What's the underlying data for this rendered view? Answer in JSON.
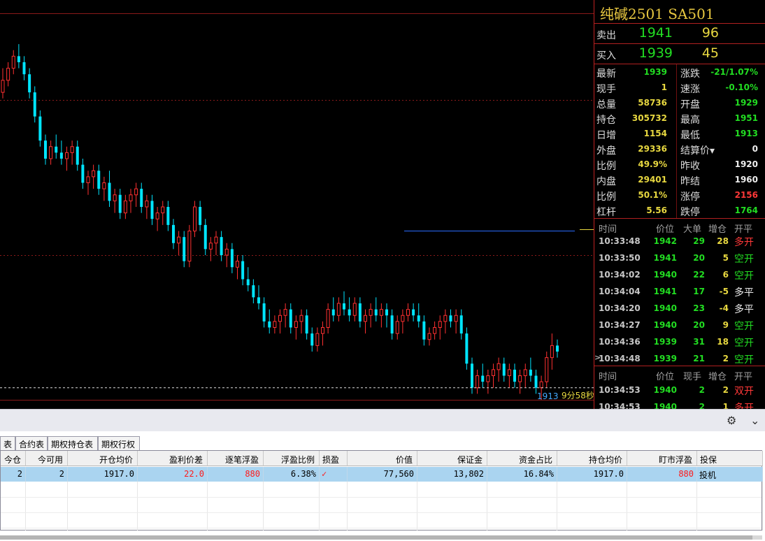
{
  "quote": {
    "title": "纯碱2501 SA501",
    "orderbook": [
      {
        "label": "卖出",
        "price": "1941",
        "volume": "96"
      },
      {
        "label": "买入",
        "price": "1939",
        "volume": "45"
      }
    ],
    "stats": [
      {
        "l1": "最新",
        "v1": "1939",
        "c1": "grn",
        "l2": "涨跌",
        "v2": "-21/1.07%",
        "c2": "grn"
      },
      {
        "l1": "现手",
        "v1": "1",
        "c1": "yel",
        "l2": "速涨",
        "v2": "-0.10%",
        "c2": "grn"
      },
      {
        "l1": "总量",
        "v1": "58736",
        "c1": "yel",
        "l2": "开盘",
        "v2": "1929",
        "c2": "grn"
      },
      {
        "l1": "持仓",
        "v1": "305732",
        "c1": "yel",
        "l2": "最高",
        "v2": "1951",
        "c2": "grn"
      },
      {
        "l1": "日增",
        "v1": "1154",
        "c1": "yel",
        "l2": "最低",
        "v2": "1913",
        "c2": "grn"
      },
      {
        "l1": "外盘",
        "v1": "29336",
        "c1": "yel",
        "l2": "结算价▾",
        "v2": "0",
        "c2": "wht"
      },
      {
        "l1": "比例",
        "v1": "49.9%",
        "c1": "yel",
        "l2": "昨收",
        "v2": "1920",
        "c2": "wht"
      },
      {
        "l1": "内盘",
        "v1": "29401",
        "c1": "yel",
        "l2": "昨结",
        "v2": "1960",
        "c2": "wht"
      },
      {
        "l1": "比例",
        "v1": "50.1%",
        "c1": "yel",
        "l2": "涨停",
        "v2": "2156",
        "c2": "red"
      },
      {
        "l1": "杠杆",
        "v1": "5.56",
        "c1": "yel",
        "l2": "跌停",
        "v2": "1764",
        "c2": "grn"
      }
    ],
    "ticks_header": [
      "时间",
      "价位",
      "大单",
      "增仓",
      "开平"
    ],
    "ticks": [
      {
        "time": "10:33:48",
        "price": "1942",
        "big": "29",
        "big_color": "red",
        "add": "28",
        "add_color": "yel",
        "type": "多开",
        "type_color": "red"
      },
      {
        "time": "10:33:50",
        "price": "1941",
        "big": "20",
        "big_color": "grn",
        "add": "5",
        "add_color": "yel",
        "type": "空开",
        "type_color": "grn"
      },
      {
        "time": "10:34:02",
        "price": "1940",
        "big": "22",
        "big_color": "grn",
        "add": "6",
        "add_color": "yel",
        "type": "空开",
        "type_color": "grn"
      },
      {
        "time": "10:34:04",
        "price": "1941",
        "big": "17",
        "big_color": "grn",
        "add": "-5",
        "add_color": "yel",
        "type": "多平",
        "type_color": "wht"
      },
      {
        "time": "10:34:20",
        "price": "1940",
        "big": "23",
        "big_color": "grn",
        "add": "-4",
        "add_color": "yel",
        "type": "多平",
        "type_color": "wht"
      },
      {
        "time": "10:34:27",
        "price": "1940",
        "big": "20",
        "big_color": "grn",
        "add": "9",
        "add_color": "yel",
        "type": "空开",
        "type_color": "grn"
      },
      {
        "time": "10:34:36",
        "price": "1939",
        "big": "31",
        "big_color": "grn",
        "add": "18",
        "add_color": "yel",
        "type": "空开",
        "type_color": "grn"
      },
      {
        "time": "10:34:48",
        "price": "1939",
        "big": "21",
        "big_color": "grn",
        "add": "2",
        "add_color": "yel",
        "type": "空开",
        "type_color": "grn"
      }
    ],
    "ticks2_header": [
      "时间",
      "价位",
      "现手",
      "增仓",
      "开平"
    ],
    "ticks2": [
      {
        "time": "10:34:53",
        "price": "1940",
        "big": "2",
        "big_color": "red",
        "add": "2",
        "add_color": "yel",
        "type": "双开",
        "type_color": "red"
      },
      {
        "time": "10:34:53",
        "price": "1940",
        "big": "2",
        "big_color": "red",
        "add": "1",
        "add_color": "yel",
        "type": "多开",
        "type_color": "red"
      }
    ]
  },
  "chart": {
    "low_label": "1913",
    "countdown_label": "9分58秒",
    "colors": {
      "up": "#ff3030",
      "down": "#00e5ff",
      "grid": "#8b1a1a",
      "line": "#2a6cff"
    }
  },
  "chart_data": {
    "type": "candlestick",
    "title": "",
    "ylim": [
      1911,
      1975
    ],
    "reference_lines": {
      "last_price": 1939,
      "low": 1913
    },
    "candles": [
      [
        1962,
        1966,
        1961,
        1964
      ],
      [
        1964,
        1967,
        1963,
        1966
      ],
      [
        1966,
        1969,
        1965,
        1968
      ],
      [
        1968,
        1970,
        1966,
        1967
      ],
      [
        1967,
        1968,
        1964,
        1965
      ],
      [
        1965,
        1966,
        1961,
        1962
      ],
      [
        1962,
        1963,
        1957,
        1958
      ],
      [
        1958,
        1959,
        1953,
        1954
      ],
      [
        1954,
        1955,
        1950,
        1951
      ],
      [
        1951,
        1954,
        1950,
        1953
      ],
      [
        1953,
        1955,
        1951,
        1952
      ],
      [
        1952,
        1954,
        1950,
        1951
      ],
      [
        1951,
        1953,
        1949,
        1952
      ],
      [
        1952,
        1954,
        1950,
        1953
      ],
      [
        1953,
        1954,
        1949,
        1950
      ],
      [
        1950,
        1951,
        1946,
        1947
      ],
      [
        1947,
        1949,
        1945,
        1948
      ],
      [
        1948,
        1950,
        1946,
        1949
      ],
      [
        1949,
        1950,
        1945,
        1946
      ],
      [
        1946,
        1948,
        1944,
        1947
      ],
      [
        1947,
        1949,
        1943,
        1944
      ],
      [
        1944,
        1946,
        1942,
        1945
      ],
      [
        1945,
        1946,
        1941,
        1942
      ],
      [
        1942,
        1945,
        1941,
        1944
      ],
      [
        1944,
        1946,
        1942,
        1945
      ],
      [
        1945,
        1947,
        1943,
        1946
      ],
      [
        1946,
        1947,
        1942,
        1943
      ],
      [
        1943,
        1945,
        1941,
        1944
      ],
      [
        1944,
        1945,
        1940,
        1941
      ],
      [
        1941,
        1943,
        1939,
        1942
      ],
      [
        1942,
        1944,
        1940,
        1943
      ],
      [
        1943,
        1944,
        1939,
        1940
      ],
      [
        1940,
        1941,
        1936,
        1937
      ],
      [
        1937,
        1939,
        1935,
        1938
      ],
      [
        1938,
        1939,
        1933,
        1934
      ],
      [
        1934,
        1940,
        1933,
        1939
      ],
      [
        1939,
        1944,
        1938,
        1943
      ],
      [
        1943,
        1944,
        1939,
        1940
      ],
      [
        1940,
        1941,
        1935,
        1936
      ],
      [
        1936,
        1938,
        1934,
        1937
      ],
      [
        1937,
        1939,
        1935,
        1938
      ],
      [
        1938,
        1939,
        1934,
        1935
      ],
      [
        1935,
        1937,
        1933,
        1936
      ],
      [
        1936,
        1937,
        1932,
        1933
      ],
      [
        1933,
        1935,
        1931,
        1934
      ],
      [
        1934,
        1935,
        1930,
        1931
      ],
      [
        1931,
        1933,
        1929,
        1930
      ],
      [
        1930,
        1931,
        1927,
        1928
      ],
      [
        1928,
        1930,
        1926,
        1927
      ],
      [
        1927,
        1928,
        1923,
        1924
      ],
      [
        1924,
        1926,
        1922,
        1923
      ],
      [
        1923,
        1925,
        1922,
        1924
      ],
      [
        1924,
        1926,
        1922,
        1925
      ],
      [
        1925,
        1927,
        1923,
        1926
      ],
      [
        1926,
        1927,
        1922,
        1923
      ],
      [
        1923,
        1925,
        1921,
        1924
      ],
      [
        1924,
        1926,
        1922,
        1925
      ],
      [
        1925,
        1926,
        1921,
        1922
      ],
      [
        1922,
        1923,
        1919,
        1920
      ],
      [
        1920,
        1923,
        1919,
        1922
      ],
      [
        1922,
        1924,
        1920,
        1923
      ],
      [
        1923,
        1927,
        1922,
        1926
      ],
      [
        1926,
        1928,
        1924,
        1925
      ],
      [
        1925,
        1928,
        1924,
        1927
      ],
      [
        1927,
        1929,
        1925,
        1926
      ],
      [
        1926,
        1928,
        1924,
        1925
      ],
      [
        1925,
        1928,
        1924,
        1927
      ],
      [
        1927,
        1928,
        1923,
        1924
      ],
      [
        1924,
        1926,
        1922,
        1925
      ],
      [
        1925,
        1927,
        1923,
        1926
      ],
      [
        1926,
        1928,
        1924,
        1925
      ],
      [
        1925,
        1927,
        1923,
        1926
      ],
      [
        1926,
        1927,
        1923,
        1925
      ],
      [
        1925,
        1926,
        1921,
        1922
      ],
      [
        1922,
        1925,
        1921,
        1924
      ],
      [
        1924,
        1926,
        1922,
        1925
      ],
      [
        1925,
        1927,
        1924,
        1926
      ],
      [
        1926,
        1927,
        1924,
        1925
      ],
      [
        1925,
        1927,
        1923,
        1924
      ],
      [
        1924,
        1925,
        1920,
        1921
      ],
      [
        1921,
        1923,
        1920,
        1922
      ],
      [
        1922,
        1924,
        1921,
        1923
      ],
      [
        1923,
        1925,
        1921,
        1924
      ],
      [
        1924,
        1926,
        1922,
        1925
      ],
      [
        1925,
        1926,
        1923,
        1924
      ],
      [
        1924,
        1926,
        1922,
        1925
      ],
      [
        1925,
        1926,
        1921,
        1922
      ],
      [
        1922,
        1923,
        1916,
        1917
      ],
      [
        1917,
        1918,
        1912,
        1913
      ],
      [
        1913,
        1916,
        1912,
        1915
      ],
      [
        1915,
        1917,
        1913,
        1914
      ],
      [
        1914,
        1916,
        1912,
        1915
      ],
      [
        1915,
        1917,
        1913,
        1916
      ],
      [
        1916,
        1918,
        1914,
        1917
      ],
      [
        1917,
        1918,
        1914,
        1915
      ],
      [
        1915,
        1917,
        1913,
        1916
      ],
      [
        1916,
        1917,
        1913,
        1914
      ],
      [
        1914,
        1916,
        1912,
        1915
      ],
      [
        1915,
        1917,
        1913,
        1916
      ],
      [
        1916,
        1918,
        1914,
        1915
      ],
      [
        1915,
        1916,
        1912,
        1913
      ],
      [
        1913,
        1915,
        1911,
        1914
      ],
      [
        1914,
        1919,
        1913,
        1918
      ],
      [
        1918,
        1922,
        1916,
        1920
      ],
      [
        1920,
        1921,
        1918,
        1919
      ]
    ]
  },
  "toolbar": {
    "settings_icon": "gear-icon",
    "collapse_icon": "chevron-down-icon"
  },
  "tabs": [
    "表",
    "合约表",
    "期权持仓表",
    "期权行权"
  ],
  "grid": {
    "columns": [
      "今仓",
      "今可用",
      "开仓均价",
      "盈利价差",
      "逐笔浮盈",
      "浮盈比例",
      "损盈",
      "价值",
      "保证金",
      "资金占比",
      "持仓均价",
      "盯市浮盈",
      "投保"
    ],
    "row": [
      "2",
      "2",
      "1917.0",
      "22.0",
      "880",
      "6.38%",
      "✓",
      "77,560",
      "13,802",
      "16.84%",
      "1917.0",
      "880",
      "投机"
    ]
  }
}
